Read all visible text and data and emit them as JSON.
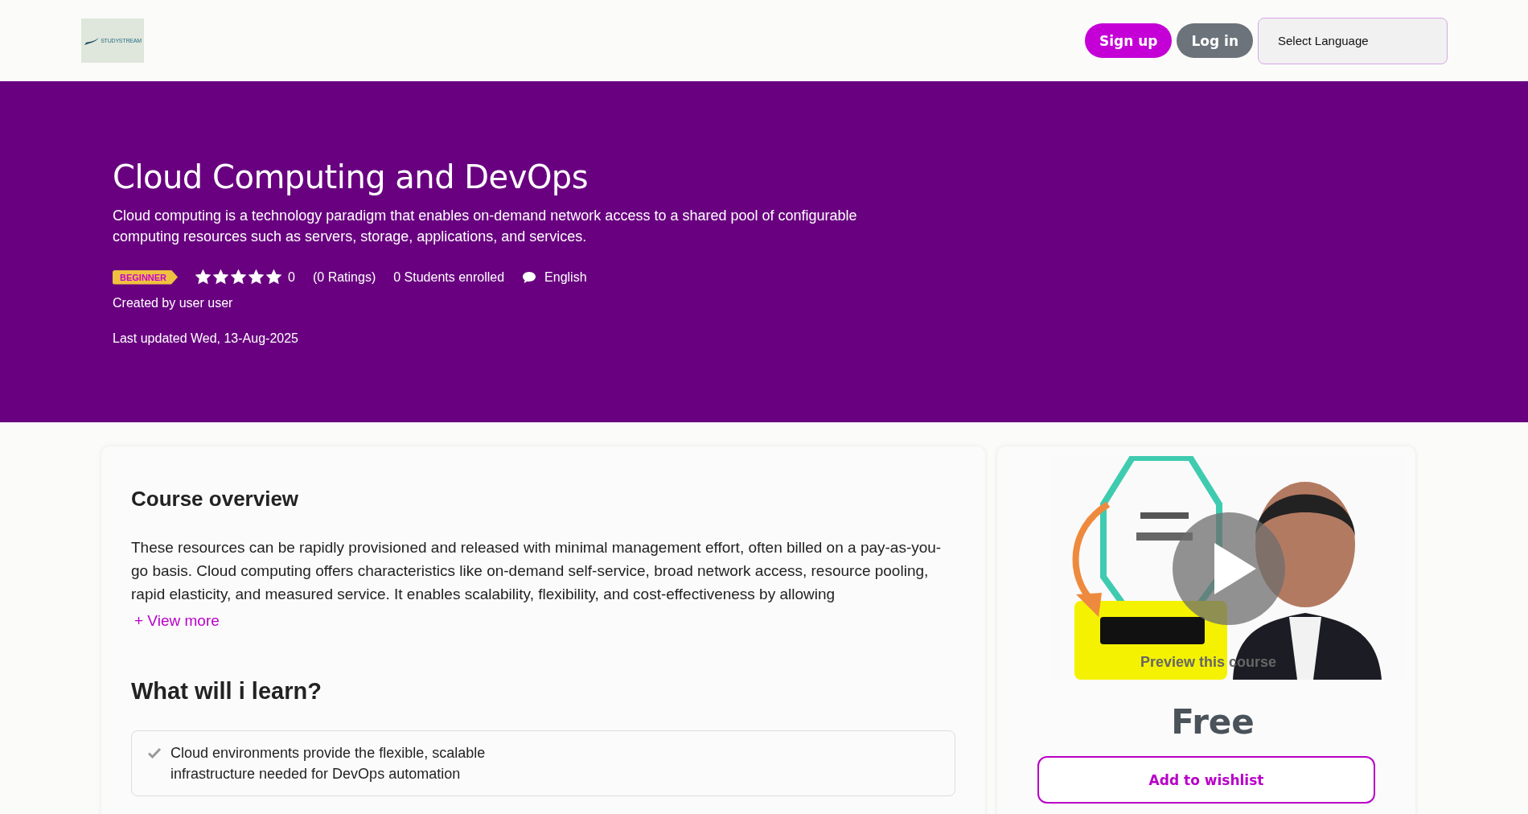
{
  "header": {
    "logo": "STUDYSTREAM",
    "buttons": [
      {
        "label": "Sign up",
        "kind": "primary"
      },
      {
        "label": "Log in",
        "kind": "secondary"
      }
    ],
    "language_select": {
      "value": "Select Language"
    }
  },
  "hero": {
    "title": "Cloud Computing and DevOps",
    "description": "Cloud computing is a technology paradigm that enables on-demand network access to a shared pool of configurable computing resources such as servers, storage, applications, and services.",
    "level_badge": "BEGINNER",
    "stars": 5,
    "rating": "0",
    "ratings_count": "(0 Ratings)",
    "students": "0 Students enrolled",
    "language": "English",
    "created_by": "Created by user user",
    "last_updated": "Last updated Wed, 13-Aug-2025"
  },
  "overview": {
    "heading": "Course overview",
    "text": "These resources can be rapidly provisioned and released with minimal management effort, often billed on a pay-as-you-go basis. Cloud computing offers characteristics like on-demand self-service, broad network access, resource pooling, rapid elasticity, and measured service. It enables scalability, flexibility, and cost-effectiveness by allowing",
    "view_more": "+ View more"
  },
  "learn": {
    "heading": "What will i learn?",
    "items": [
      "Cloud environments provide the flexible, scalable infrastructure needed for DevOps automation"
    ]
  },
  "sidebar": {
    "preview": {
      "caption": "Preview this course"
    },
    "price": "Free",
    "wishlist_button": "Add to wishlist"
  }
}
